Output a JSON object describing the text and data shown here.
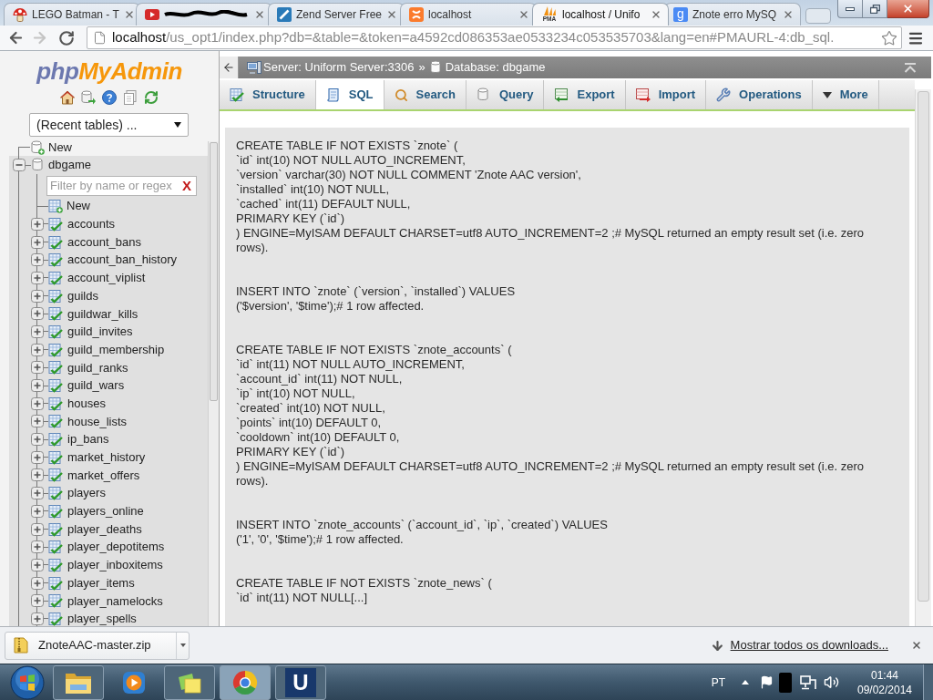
{
  "browser": {
    "tabs": [
      {
        "title": "LEGO Batman - T",
        "redacted": false,
        "selected": false
      },
      {
        "redacted": true,
        "selected": false
      },
      {
        "title": "Zend Server Free",
        "redacted": false,
        "selected": false
      },
      {
        "title": "localhost",
        "redacted": false,
        "selected": false
      },
      {
        "title": "localhost / Unifo",
        "favicon_text": "PMA",
        "redacted": false,
        "selected": true
      },
      {
        "title": "Znote erro MySQ",
        "favicon_text": "g",
        "redacted": false,
        "selected": false
      }
    ],
    "toolbar": {
      "forward_disabled": true,
      "url_host": "localhost",
      "url_path": "/us_opt1/index.php?db=&table=&token=a4592cd086353ae0533234c053535703&lang=en#PMAURL-4:db_sql."
    }
  },
  "sidebar": {
    "logo": {
      "part_1": "php",
      "part_2": "MyAdmin"
    },
    "recent_tables": "(Recent tables) ...",
    "tree": [
      {
        "label": "New",
        "kind": "new"
      },
      {
        "label": "dbgame",
        "kind": "database",
        "expanded": true,
        "filter": {
          "placeholder": "Filter by name or regex",
          "clear": "X"
        },
        "children": [
          {
            "label": "New",
            "kind": "new"
          },
          {
            "label": "accounts",
            "kind": "table",
            "expanded": false
          },
          {
            "label": "account_bans",
            "kind": "table",
            "expanded": false
          },
          {
            "label": "account_ban_history",
            "kind": "table",
            "expanded": false
          },
          {
            "label": "account_viplist",
            "kind": "table",
            "expanded": false
          },
          {
            "label": "guilds",
            "kind": "table",
            "expanded": false
          },
          {
            "label": "guildwar_kills",
            "kind": "table",
            "expanded": false
          },
          {
            "label": "guild_invites",
            "kind": "table",
            "expanded": false
          },
          {
            "label": "guild_membership",
            "kind": "table",
            "expanded": false
          },
          {
            "label": "guild_ranks",
            "kind": "table",
            "expanded": false
          },
          {
            "label": "guild_wars",
            "kind": "table",
            "expanded": false
          },
          {
            "label": "houses",
            "kind": "table",
            "expanded": false
          },
          {
            "label": "house_lists",
            "kind": "table",
            "expanded": false
          },
          {
            "label": "ip_bans",
            "kind": "table",
            "expanded": false
          },
          {
            "label": "market_history",
            "kind": "table",
            "expanded": false
          },
          {
            "label": "market_offers",
            "kind": "table",
            "expanded": false
          },
          {
            "label": "players",
            "kind": "table",
            "expanded": false
          },
          {
            "label": "players_online",
            "kind": "table",
            "expanded": false
          },
          {
            "label": "player_deaths",
            "kind": "table",
            "expanded": false
          },
          {
            "label": "player_depotitems",
            "kind": "table",
            "expanded": false
          },
          {
            "label": "player_inboxitems",
            "kind": "table",
            "expanded": false
          },
          {
            "label": "player_items",
            "kind": "table",
            "expanded": false
          },
          {
            "label": "player_namelocks",
            "kind": "table",
            "expanded": false
          },
          {
            "label": "player_spells",
            "kind": "table",
            "expanded": false
          }
        ]
      }
    ]
  },
  "main": {
    "breadcrumb": {
      "server": "Server: Uniform Server:3306",
      "separator": "»",
      "database": "Database: dbgame"
    },
    "tabs": [
      {
        "label": "Structure",
        "selected": false
      },
      {
        "label": "SQL",
        "selected": true
      },
      {
        "label": "Search",
        "selected": false
      },
      {
        "label": "Query",
        "selected": false
      },
      {
        "label": "Export",
        "selected": false
      },
      {
        "label": "Import",
        "selected": false
      },
      {
        "label": "Operations",
        "selected": false
      },
      {
        "label": "More",
        "selected": false
      }
    ],
    "sql_log": [
      [
        "CREATE TABLE IF NOT EXISTS `znote` (",
        "`id` int(10) NOT NULL AUTO_INCREMENT,",
        "`version` varchar(30) NOT NULL COMMENT 'Znote AAC version',",
        "`installed` int(10) NOT NULL,",
        "`cached` int(11) DEFAULT NULL,",
        "PRIMARY KEY (`id`)",
        ") ENGINE=MyISAM DEFAULT CHARSET=utf8 AUTO_INCREMENT=2 ;# MySQL returned an empty result set (i.e. zero rows)."
      ],
      [
        "INSERT INTO `znote` (`version`, `installed`) VALUES",
        "('$version', '$time');# 1 row affected."
      ],
      [
        "CREATE TABLE IF NOT EXISTS `znote_accounts` (",
        "`id` int(11) NOT NULL AUTO_INCREMENT,",
        "`account_id` int(11) NOT NULL,",
        "`ip` int(10) NOT NULL,",
        "`created` int(10) NOT NULL,",
        "`points` int(10) DEFAULT 0,",
        "`cooldown` int(10) DEFAULT 0,",
        "PRIMARY KEY (`id`)",
        ") ENGINE=MyISAM DEFAULT CHARSET=utf8 AUTO_INCREMENT=2 ;# MySQL returned an empty result set (i.e. zero rows)."
      ],
      [
        "INSERT INTO `znote_accounts` (`account_id`, `ip`, `created`) VALUES",
        "('1', '0', '$time');# 1 row affected."
      ],
      [
        "CREATE TABLE IF NOT EXISTS `znote_news` (",
        "`id` int(11) NOT NULL[...]"
      ]
    ]
  },
  "downloads_bar": {
    "file": "ZnoteAAC-master.zip",
    "show_all": "Mostrar todos os downloads..."
  },
  "taskbar": {
    "apps": [
      {
        "running": true,
        "selected": false
      },
      {
        "running": false,
        "selected": false
      },
      {
        "running": true,
        "selected": false
      },
      {
        "running": true,
        "selected": true
      },
      {
        "running": true,
        "selected": false,
        "glyph": "U"
      }
    ],
    "language": "PT",
    "time": "01:44",
    "date": "09/02/2014"
  }
}
